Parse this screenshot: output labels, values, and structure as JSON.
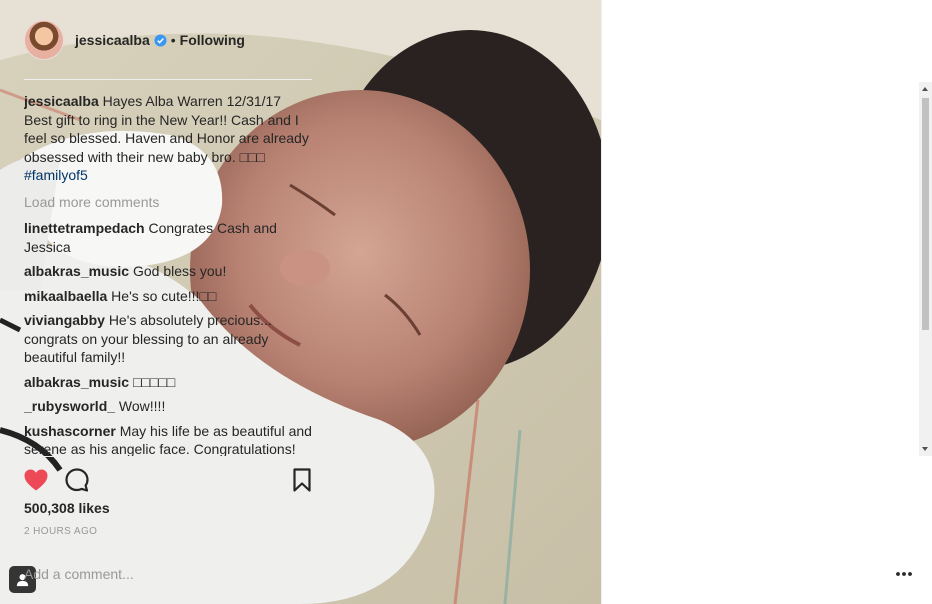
{
  "post": {
    "username": "jessicaalba",
    "separator": "•",
    "follow_label": "Following",
    "caption_user": "jessicaalba",
    "caption_text": "Hayes Alba Warren 12/31/17 Best gift to ring in the New Year!! Cash and I feel so blessed. Haven and Honor are already obsessed with their new baby bro. □□□ ",
    "caption_hashtag": "#familyof5",
    "load_more": "Load more comments",
    "comments": [
      {
        "user": "linettetrampedach",
        "text": "Congrates Cash and Jessica"
      },
      {
        "user": "albakras_music",
        "text": "God bless you!"
      },
      {
        "user": "mikaalbaella",
        "text": "He's so cute!!!□□"
      },
      {
        "user": "viviangabby",
        "text": "He's absolutely precious... congrats on your blessing to an already beautiful family!!"
      },
      {
        "user": "albakras_music",
        "text": "□□□□□"
      },
      {
        "user": "_rubysworld_",
        "text": "Wow!!!!"
      },
      {
        "user": "kushascorner",
        "text": "May his life be as beautiful and serene as his angelic face. Congratulations!"
      }
    ],
    "likes": "500,308 likes",
    "time": "2 HOURS AGO",
    "add_comment_placeholder": "Add a comment...",
    "more_label": "•••"
  },
  "colors": {
    "heart": "#ed4956",
    "verified": "#3897f0",
    "hashtag": "#003569",
    "muted": "#999999"
  },
  "icons": {
    "heart": "heart-icon",
    "comment": "comment-icon",
    "bookmark": "bookmark-icon",
    "verified": "verified-badge-icon",
    "tag": "user-tag-icon",
    "more": "more-options-icon"
  }
}
